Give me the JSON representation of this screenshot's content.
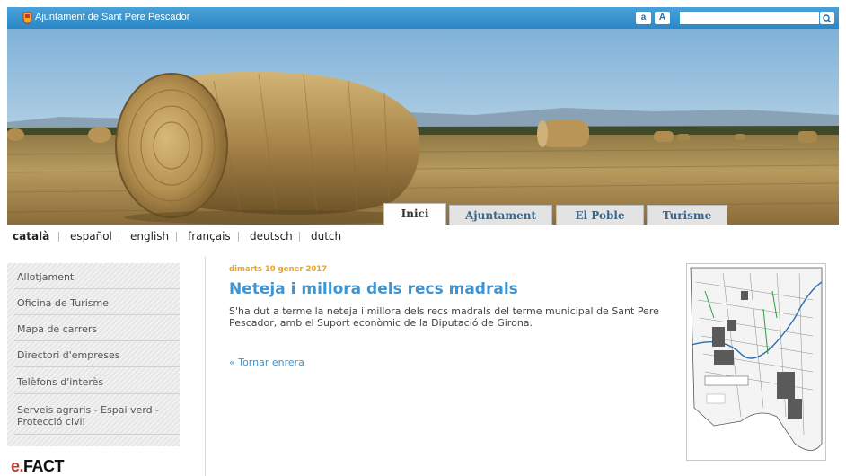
{
  "header": {
    "site_title": "Ajuntament de Sant Pere Pescador",
    "font_small_label": "a",
    "font_large_label": "A",
    "search_placeholder": "",
    "search_icon": "search-icon",
    "accent_color": "#2b86c6"
  },
  "nav": {
    "tabs": [
      {
        "label": "Inici",
        "active": true
      },
      {
        "label": "Ajuntament",
        "active": false
      },
      {
        "label": "El Poble",
        "active": false
      },
      {
        "label": "Turisme",
        "active": false
      }
    ]
  },
  "languages": [
    {
      "label": "català",
      "selected": true
    },
    {
      "label": "español",
      "selected": false
    },
    {
      "label": "english",
      "selected": false
    },
    {
      "label": "français",
      "selected": false
    },
    {
      "label": "deutsch",
      "selected": false
    },
    {
      "label": "dutch",
      "selected": false
    }
  ],
  "sidebar": {
    "items": [
      {
        "label": "Allotjament"
      },
      {
        "label": "Oficina de Turisme"
      },
      {
        "label": "Mapa de carrers"
      },
      {
        "label": "Directori d'empreses"
      },
      {
        "label": "Telèfons d'interès"
      },
      {
        "label": "Serveis agraris - Espai verd - Protecció civil"
      }
    ],
    "logo_text_prefix": "e.",
    "logo_text_brand": "FACT"
  },
  "article": {
    "date": "dimarts 10 gener 2017",
    "title": "Neteja i millora dels recs madrals",
    "body": "S'ha dut a terme la neteja i millora dels recs madrals del terme municipal de Sant Pere Pescador, amb el Suport econòmic de la Diputació de Girona.",
    "back_link": "« Tornar enrera",
    "title_color": "#3f94d1",
    "date_color": "#e9a325"
  }
}
